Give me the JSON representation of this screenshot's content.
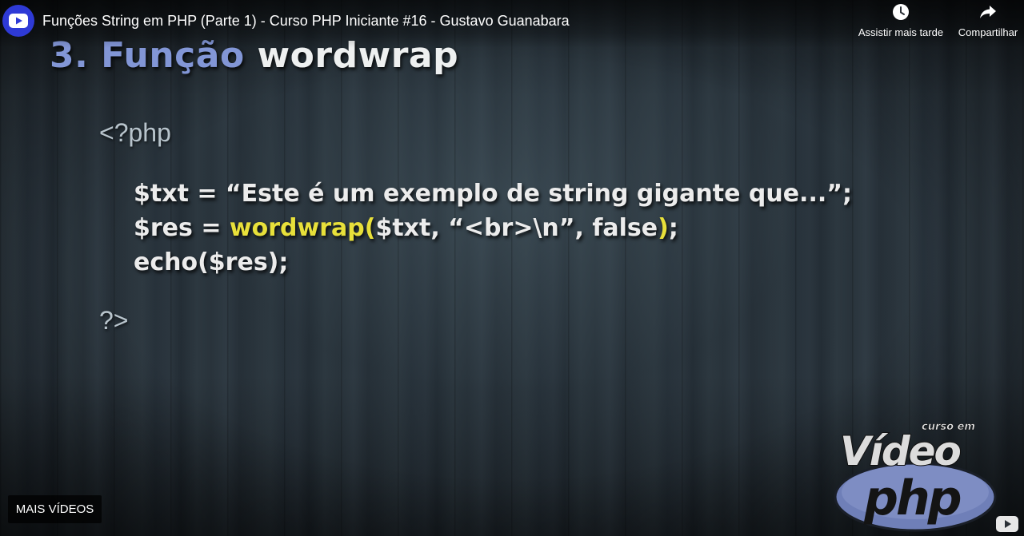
{
  "header": {
    "video_title": "Funções String em PHP (Parte 1) - Curso PHP Iniciante #16 - Gustavo Guanabara",
    "channel_icon": "play-icon",
    "actions": [
      {
        "label": "Assistir mais tarde",
        "icon": "clock-icon"
      },
      {
        "label": "Compartilhar",
        "icon": "share-arrow-icon"
      }
    ]
  },
  "slide": {
    "title_number": "3.",
    "title_keyword": "Função",
    "title_function": "wordwrap",
    "php_open": "<?php",
    "php_close": "?>",
    "code": {
      "line1": "$txt = “Este é um exemplo de string gigante que...”;",
      "line2_pre": "$res = ",
      "line2_hl": "wordwrap(",
      "line2_mid": "$txt, “<br>\\n”, false",
      "line2_hl_end": ")",
      "line2_post": ";",
      "line3": "echo($res);"
    }
  },
  "logo": {
    "small": "curso em",
    "big": "Vídeo",
    "brand": "php"
  },
  "overlay": {
    "more_videos": "MAIS VÍDEOS"
  },
  "colors": {
    "title_blue": "#8296d6",
    "highlight_yellow": "#e8e03a",
    "channel_blue": "#2e3ad6"
  }
}
